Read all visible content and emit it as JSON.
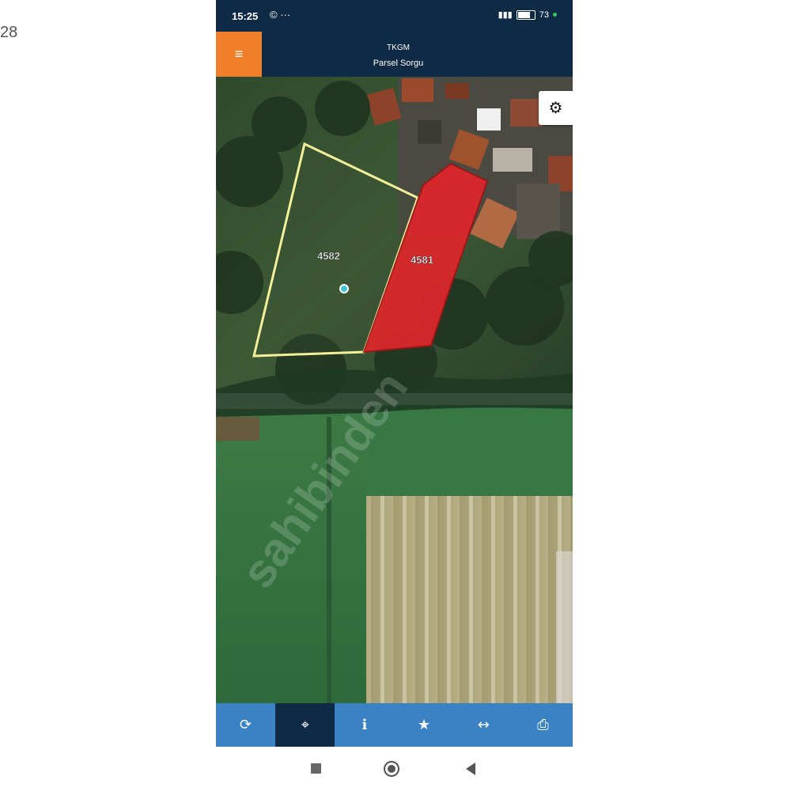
{
  "page_corner": {
    "text": "28"
  },
  "status_bar": {
    "time": "15:25",
    "left_icons": "© ···",
    "battery_percent": "73"
  },
  "header": {
    "menu_icon": "menu-icon",
    "title": "TKGM",
    "subtitle": "Parsel Sorgu"
  },
  "map": {
    "parcels": [
      {
        "label": "4582",
        "outline_color": "#f3ef9a",
        "fill": "none"
      },
      {
        "label": "4581",
        "outline_color": "#a01414",
        "fill": "#e0262b"
      }
    ],
    "watermark": "sahibinden",
    "settings_icon": "gear-icon"
  },
  "toolbar": {
    "buttons": [
      {
        "icon": "refresh-icon",
        "glyph": "⟳",
        "active": false
      },
      {
        "icon": "locate-icon",
        "glyph": "⌖",
        "active": true
      },
      {
        "icon": "info-icon",
        "glyph": "i",
        "active": false
      },
      {
        "icon": "star-icon",
        "glyph": "★",
        "active": false
      },
      {
        "icon": "measure-icon",
        "glyph": "↔",
        "active": false
      },
      {
        "icon": "print-icon",
        "glyph": "⎙",
        "active": false
      }
    ]
  },
  "nav_bar": {
    "icons": [
      "recents-icon",
      "home-icon",
      "back-icon"
    ]
  }
}
